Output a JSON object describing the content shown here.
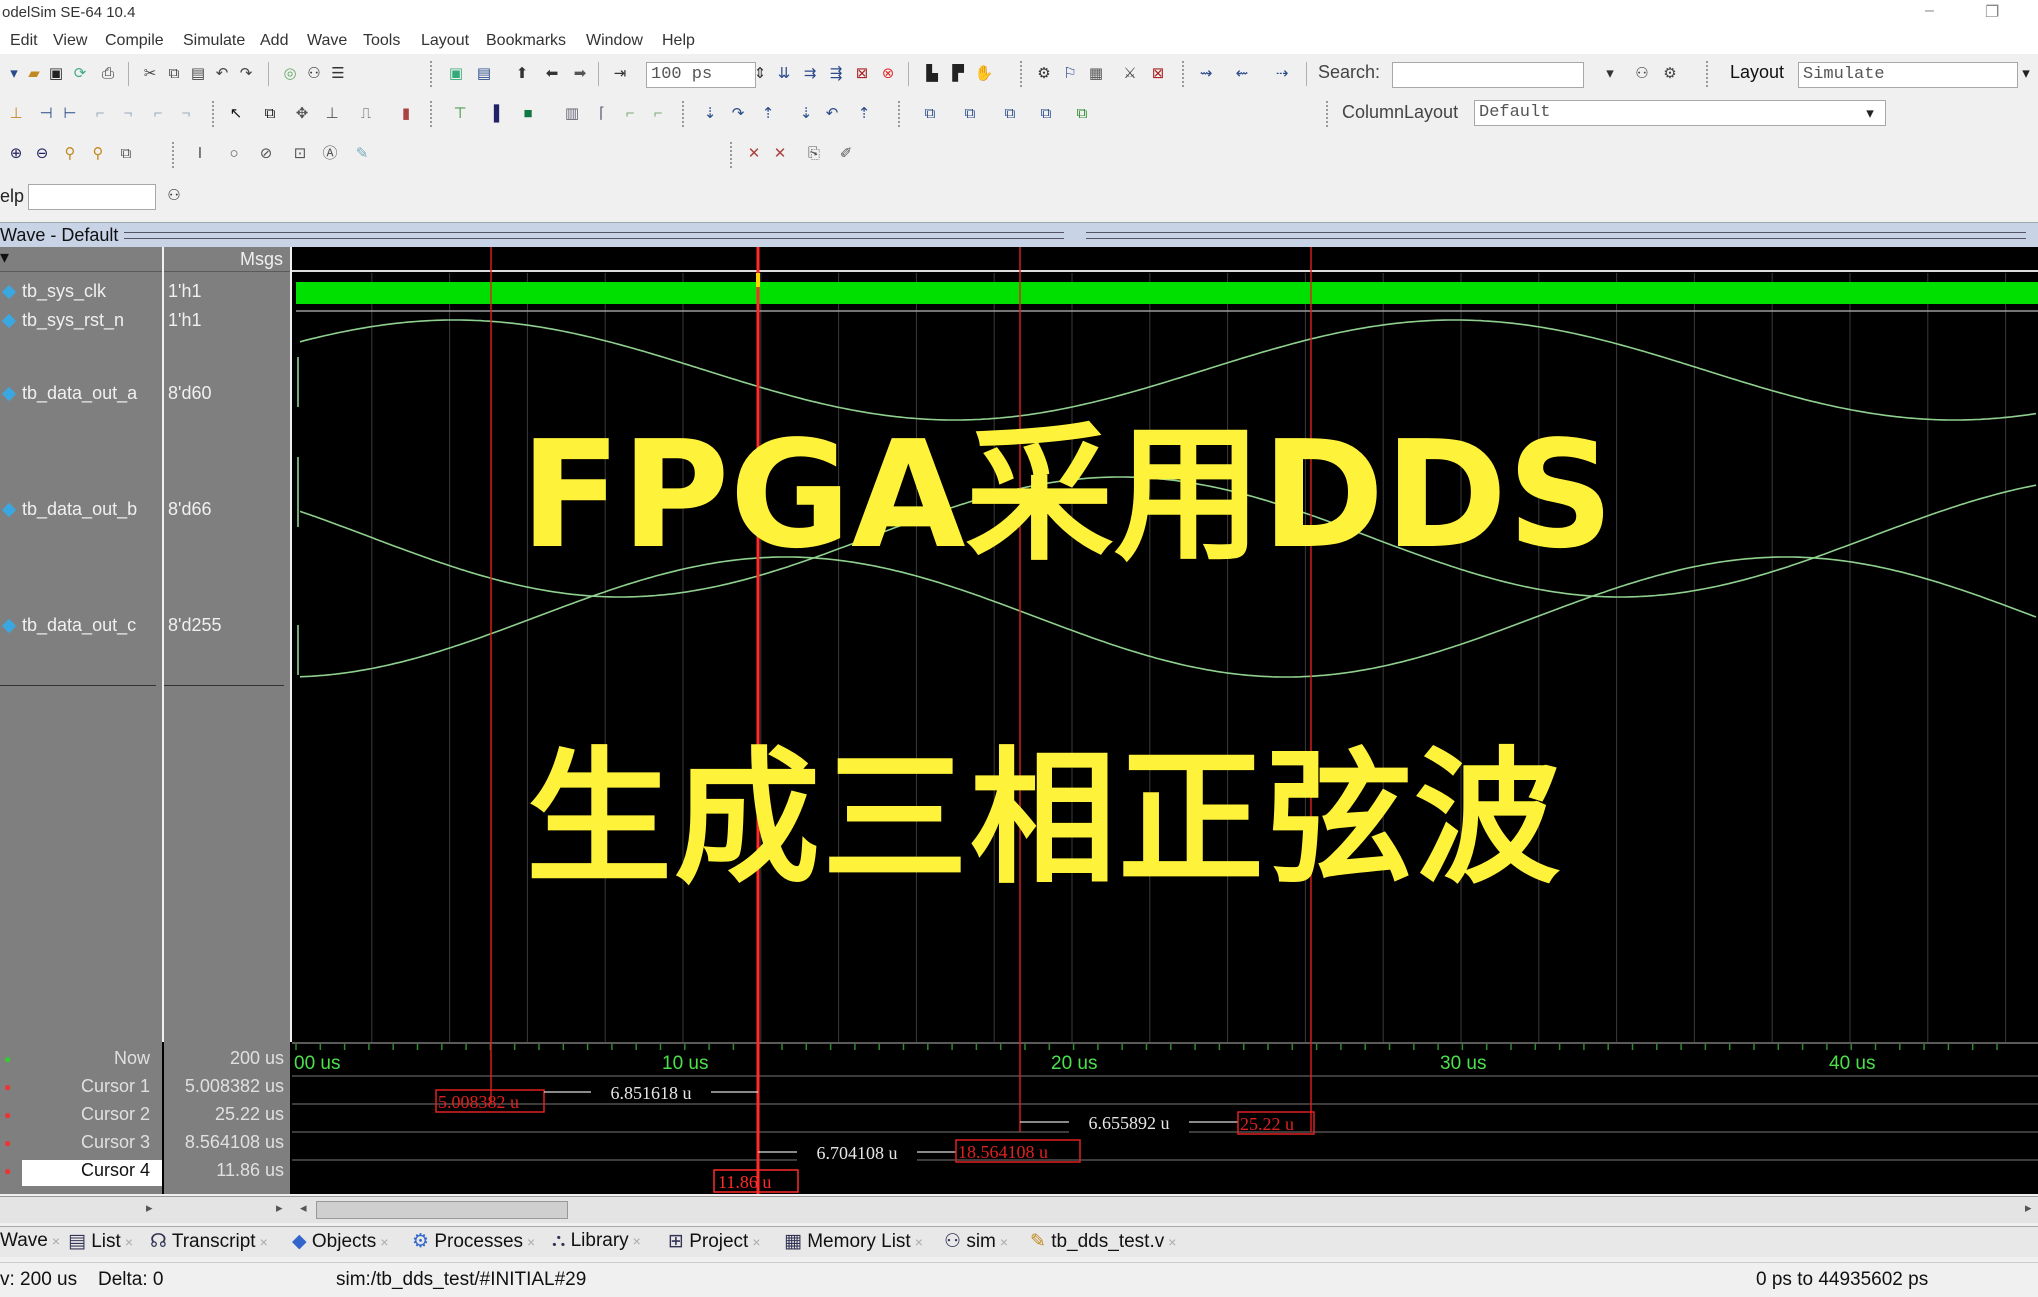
{
  "window": {
    "title": "odelSim SE-64 10.4"
  },
  "menu": [
    "Edit",
    "View",
    "Compile",
    "Simulate",
    "Add",
    "Wave",
    "Tools",
    "Layout",
    "Bookmarks",
    "Window",
    "Help"
  ],
  "toolbar": {
    "run_length": "100 ps",
    "search_label": "Search:",
    "search_value": "",
    "layout_label": "Layout",
    "layout_value": "Simulate",
    "column_layout_label": "ColumnLayout",
    "column_layout_value": "Default",
    "help_label": "elp"
  },
  "wave": {
    "title": "Wave - Default",
    "msgs_header": "Msgs",
    "signals": [
      {
        "name": "tb_sys_clk",
        "value": "1'h1"
      },
      {
        "name": "tb_sys_rst_n",
        "value": "1'h1"
      },
      {
        "name": "tb_data_out_a",
        "value": "8'd60"
      },
      {
        "name": "tb_data_out_b",
        "value": "8'd66"
      },
      {
        "name": "tb_data_out_c",
        "value": "8'd255"
      }
    ],
    "timeline_labels": [
      "00 us",
      "10 us",
      "20 us",
      "30 us",
      "40 us"
    ],
    "now_label": "Now",
    "now_value": "200 us",
    "cursors": [
      {
        "name": "Cursor 1",
        "value": "5.008382 us",
        "tag": "5.008382 u"
      },
      {
        "name": "Cursor 2",
        "value": "25.22 us",
        "tag": "25.22 u"
      },
      {
        "name": "Cursor 3",
        "value": "8.564108 us",
        "tag": "18.564108 u"
      },
      {
        "name": "Cursor 4",
        "value": "11.86 us",
        "tag": "11.86 u"
      }
    ],
    "deltas": [
      "6.851618 u",
      "6.655892 u",
      "6.704108 u"
    ],
    "colors": {
      "clk": "#00e000",
      "wave": "#8fd08f",
      "cursor": "#e02020",
      "active_cursor": "#ff2a2a",
      "timeline_text": "#4ce04c"
    }
  },
  "overlay": {
    "line1": "FPGA采用DDS",
    "line2": "生成三相正弦波",
    "color": "#fff23a"
  },
  "tabs": [
    "Wave",
    "List",
    "Transcript",
    "Objects",
    "Processes",
    "Library",
    "Project",
    "Memory List",
    "sim",
    "tb_dds_test.v"
  ],
  "status": {
    "now": "v: 200 us",
    "delta": "Delta: 0",
    "context": "sim:/tb_dds_test/#INITIAL#29",
    "range": "0 ps to 44935602 ps"
  }
}
